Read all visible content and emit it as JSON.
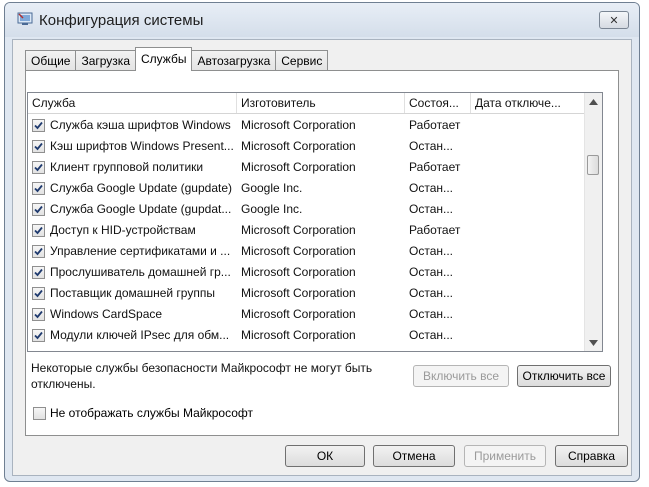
{
  "window": {
    "title": "Конфигурация системы",
    "close_label": "✕"
  },
  "tabs": [
    {
      "label": "Общие",
      "active": false
    },
    {
      "label": "Загрузка",
      "active": false
    },
    {
      "label": "Службы",
      "active": true
    },
    {
      "label": "Автозагрузка",
      "active": false
    },
    {
      "label": "Сервис",
      "active": false
    }
  ],
  "columns": {
    "service": "Служба",
    "manufacturer": "Изготовитель",
    "status": "Состоя...",
    "disabled_date": "Дата отключе..."
  },
  "services": [
    {
      "name": "Служба кэша шрифтов Windows",
      "manufacturer": "Microsoft Corporation",
      "status": "Работает",
      "checked": true
    },
    {
      "name": "Кэш шрифтов Windows Present...",
      "manufacturer": "Microsoft Corporation",
      "status": "Остан...",
      "checked": true
    },
    {
      "name": "Клиент групповой политики",
      "manufacturer": "Microsoft Corporation",
      "status": "Работает",
      "checked": true
    },
    {
      "name": "Служба Google Update (gupdate)",
      "manufacturer": "Google Inc.",
      "status": "Остан...",
      "checked": true
    },
    {
      "name": "Служба Google Update (gupdat...",
      "manufacturer": "Google Inc.",
      "status": "Остан...",
      "checked": true
    },
    {
      "name": "Доступ к HID-устройствам",
      "manufacturer": "Microsoft Corporation",
      "status": "Работает",
      "checked": true
    },
    {
      "name": "Управление сертификатами и ...",
      "manufacturer": "Microsoft Corporation",
      "status": "Остан...",
      "checked": true
    },
    {
      "name": "Прослушиватель домашней гр...",
      "manufacturer": "Microsoft Corporation",
      "status": "Остан...",
      "checked": true
    },
    {
      "name": "Поставщик домашней группы",
      "manufacturer": "Microsoft Corporation",
      "status": "Остан...",
      "checked": true
    },
    {
      "name": "Windows CardSpace",
      "manufacturer": "Microsoft Corporation",
      "status": "Остан...",
      "checked": true
    },
    {
      "name": "Модули ключей IPsec для обм...",
      "manufacturer": "Microsoft Corporation",
      "status": "Остан...",
      "checked": true
    }
  ],
  "note": "Некоторые службы безопасности Майкрософт не могут быть отключены.",
  "buttons": {
    "enable_all": "Включить все",
    "disable_all": "Отключить все",
    "ok": "ОК",
    "cancel": "Отмена",
    "apply": "Применить",
    "help": "Справка"
  },
  "hide_ms_label": "Не отображать службы Майкрософт",
  "hide_ms_checked": false
}
